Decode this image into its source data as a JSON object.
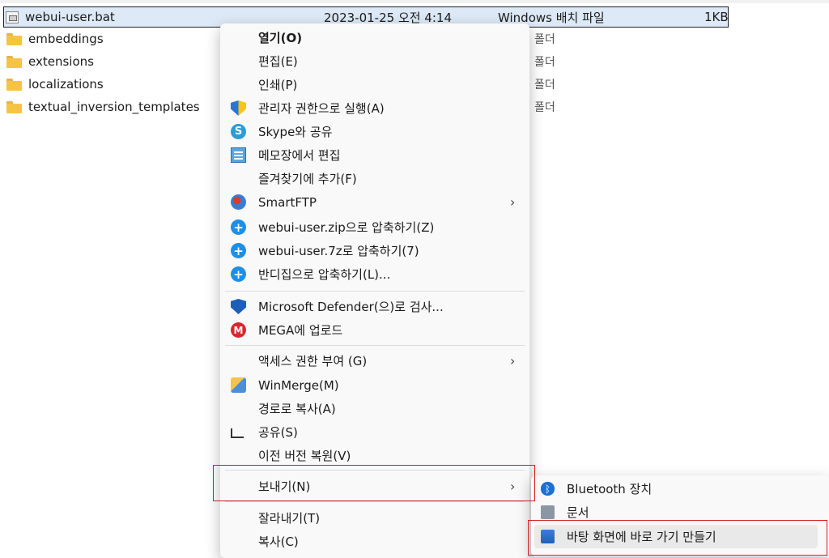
{
  "files": [
    {
      "name": "webui-user.bat",
      "date": "2023-01-25 오전 4:14",
      "type": "Windows 배치 파일",
      "size": "1KB"
    },
    {
      "name": "embeddings",
      "type_peek": "폴더"
    },
    {
      "name": "extensions",
      "type_peek": "폴더"
    },
    {
      "name": "localizations",
      "type_peek": "폴더"
    },
    {
      "name": "textual_inversion_templates",
      "type_peek": "폴더"
    }
  ],
  "menu": [
    {
      "label": "열기(O)"
    },
    {
      "label": "편집(E)"
    },
    {
      "label": "인쇄(P)"
    },
    {
      "label": "관리자 권한으로 실행(A)",
      "icon": "uac-shield-icon"
    },
    {
      "label": "Skype와 공유",
      "icon": "skype-icon"
    },
    {
      "label": "메모장에서 편집",
      "icon": "notepad-icon"
    },
    {
      "label": "즐겨찾기에 추가(F)"
    },
    {
      "label": "SmartFTP",
      "icon": "smartftp-icon",
      "arrow": "›"
    },
    {
      "label": "webui-user.zip으로 압축하기(Z)",
      "icon": "bandizip-icon"
    },
    {
      "label": "webui-user.7z로 압축하기(7)",
      "icon": "bandizip-icon"
    },
    {
      "label": "반디집으로 압축하기(L)...",
      "icon": "bandizip-icon"
    },
    {
      "label": "Microsoft Defender(으)로 검사...",
      "icon": "defender-icon"
    },
    {
      "label": "MEGA에 업로드",
      "icon": "mega-icon"
    },
    {
      "label": "액세스 권한 부여 (G)",
      "arrow": "›"
    },
    {
      "label": "WinMerge(M)",
      "icon": "winmerge-icon"
    },
    {
      "label": "경로로 복사(A)"
    },
    {
      "label": "공유(S)",
      "icon": "share-icon"
    },
    {
      "label": "이전 버전 복원(V)"
    },
    {
      "label": "보내기(N)",
      "arrow": "›"
    },
    {
      "label": "잘라내기(T)"
    },
    {
      "label": "복사(C)"
    }
  ],
  "submenu": [
    {
      "label": "Bluetooth 장치",
      "icon": "bluetooth-icon"
    },
    {
      "label": "문서",
      "icon": "documents-icon"
    },
    {
      "label": "바탕 화면에 바로 가기 만들기",
      "icon": "desktop-icon"
    }
  ],
  "colors": {
    "highlight": "#d41c1c",
    "selection": "#dde9f6"
  }
}
